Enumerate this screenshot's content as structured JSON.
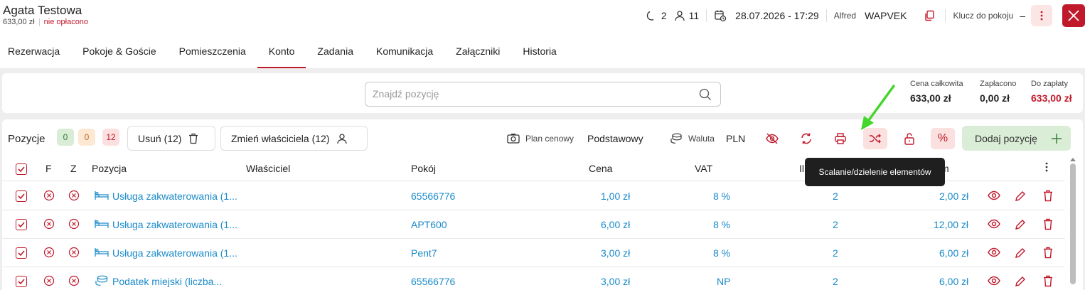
{
  "guest": {
    "name": "Agata Testowa",
    "amount": "633,00 zł",
    "payment_status": "nie opłacono"
  },
  "header": {
    "nights": "2",
    "guests": "11",
    "datetime": "28.07.2026 - 17:29",
    "user": "Alfred",
    "company": "WAPVEK",
    "room_key_label": "Klucz do pokoju",
    "room_key_value": "–"
  },
  "tabs": [
    "Rezerwacja",
    "Pokoje & Goście",
    "Pomieszczenia",
    "Konto",
    "Zadania",
    "Komunikacja",
    "Załączniki",
    "Historia"
  ],
  "active_tab": "Konto",
  "search": {
    "placeholder": "Znajdź pozycję"
  },
  "totals": {
    "total_label": "Cena całkowita",
    "total_value": "633,00 zł",
    "paid_label": "Zapłacono",
    "paid_value": "0,00 zł",
    "due_label": "Do zapłaty",
    "due_value": "633,00 zł"
  },
  "toolbar": {
    "positions_label": "Pozycje",
    "badge_green": "0",
    "badge_orange": "0",
    "badge_red": "12",
    "delete_label": "Usuń (12)",
    "change_owner_label": "Zmień właściciela (12)",
    "price_plan_label": "Plan cenowy",
    "price_plan_value": "Podstawowy",
    "currency_label": "Waluta",
    "currency_value": "PLN",
    "add_label": "Dodaj pozycję",
    "percent_symbol": "%"
  },
  "table": {
    "headers": {
      "f": "F",
      "z": "Z",
      "item": "Pozycja",
      "owner": "Właściciel",
      "room": "Pokój",
      "price": "Cena",
      "vat": "VAT",
      "qty": "Il",
      "sum": "m"
    },
    "rows": [
      {
        "item": "Usługa zakwaterowania (1...",
        "item_icon": "bed-icon",
        "owner": "",
        "room": "65566776",
        "price": "1,00 zł",
        "vat": "8 %",
        "qty": "2",
        "sum": "2,00 zł"
      },
      {
        "item": "Usługa zakwaterowania (1...",
        "item_icon": "bed-icon",
        "owner": "",
        "room": "APT600",
        "price": "6,00 zł",
        "vat": "8 %",
        "qty": "2",
        "sum": "12,00 zł"
      },
      {
        "item": "Usługa zakwaterowania (1...",
        "item_icon": "bed-icon",
        "owner": "",
        "room": "Pent7",
        "price": "3,00 zł",
        "vat": "8 %",
        "qty": "2",
        "sum": "6,00 zł"
      },
      {
        "item": "Podatek miejski (liczba...",
        "item_icon": "coins-icon",
        "owner": "",
        "room": "65566776",
        "price": "3,00 zł",
        "vat": "NP",
        "qty": "2",
        "sum": "6,00 zł"
      }
    ]
  },
  "tooltip": {
    "text": "Scalanie/dzielenie elementów"
  },
  "colors": {
    "accent_red": "#c0192b",
    "link_blue": "#1a8ac9",
    "add_green": "#d9edd7",
    "arrow_green": "#44d62c"
  }
}
